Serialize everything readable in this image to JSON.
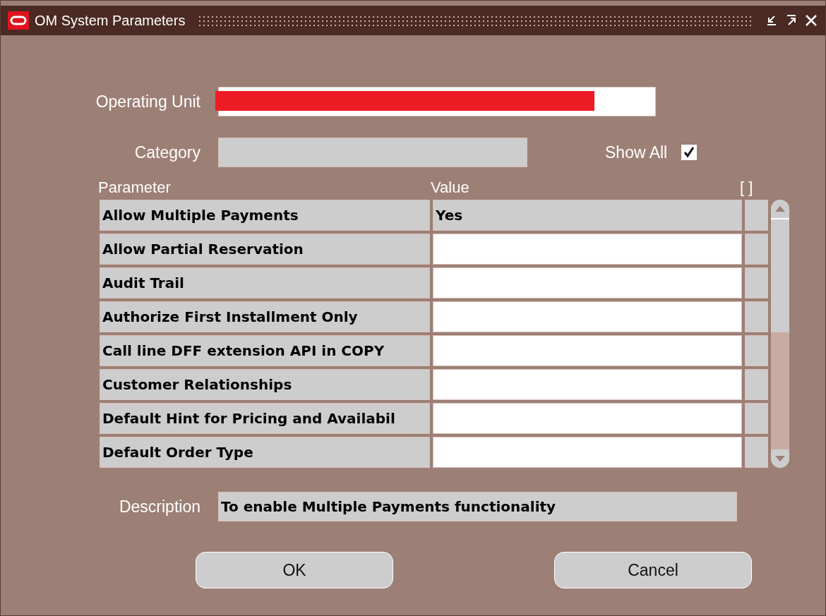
{
  "window": {
    "title": "OM System Parameters"
  },
  "operating_unit": {
    "label": "Operating Unit",
    "redacted": true
  },
  "category": {
    "label": "Category"
  },
  "show_all": {
    "label": "Show All",
    "checked": true
  },
  "table": {
    "columns": [
      "Parameter",
      "Value",
      "[ ]"
    ],
    "rows": [
      {
        "parameter": "Allow Multiple Payments",
        "value": "Yes",
        "selected": true
      },
      {
        "parameter": "Allow Partial Reservation",
        "selected": false
      },
      {
        "parameter": "Audit Trail",
        "selected": false
      },
      {
        "parameter": "Authorize First Installment Only",
        "selected": false
      },
      {
        "parameter": "Call line DFF extension API in COPY",
        "selected": false
      },
      {
        "parameter": "Customer Relationships",
        "selected": false
      },
      {
        "parameter": "Default Hint for Pricing and Availabil",
        "selected": false
      },
      {
        "parameter": "Default Order Type",
        "selected": false
      }
    ]
  },
  "description": {
    "label": "Description",
    "value": "To enable Multiple Payments functionality"
  },
  "buttons": [
    "OK",
    "Cancel"
  ]
}
